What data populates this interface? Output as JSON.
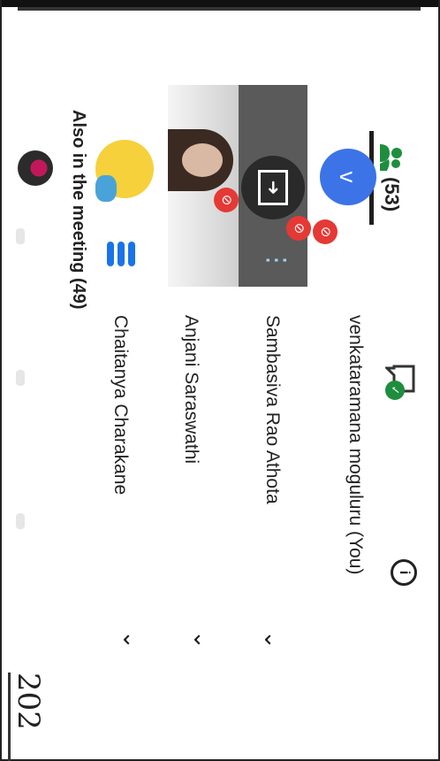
{
  "header": {
    "people_count": "(53)",
    "chat_badge": "✓",
    "info_icon": "i"
  },
  "participants": [
    {
      "avatar_letter": "v",
      "name": "venkataramana moguluru (You)",
      "muted": true
    },
    {
      "name": "Sambasiva Rao Athota",
      "muted": true,
      "presenting_icon": "➜"
    },
    {
      "name": "Anjani Saraswathi",
      "muted": true
    },
    {
      "name": "Chaitanya Charakane",
      "speaking": true
    }
  ],
  "also_in_meeting": "Also in the meeting (49)",
  "handwriting": "202",
  "colors": {
    "accent": "#1a73e8",
    "mute": "#e53935",
    "avatar_blue": "#3c73e6",
    "chat_green": "#1e8e3e"
  }
}
